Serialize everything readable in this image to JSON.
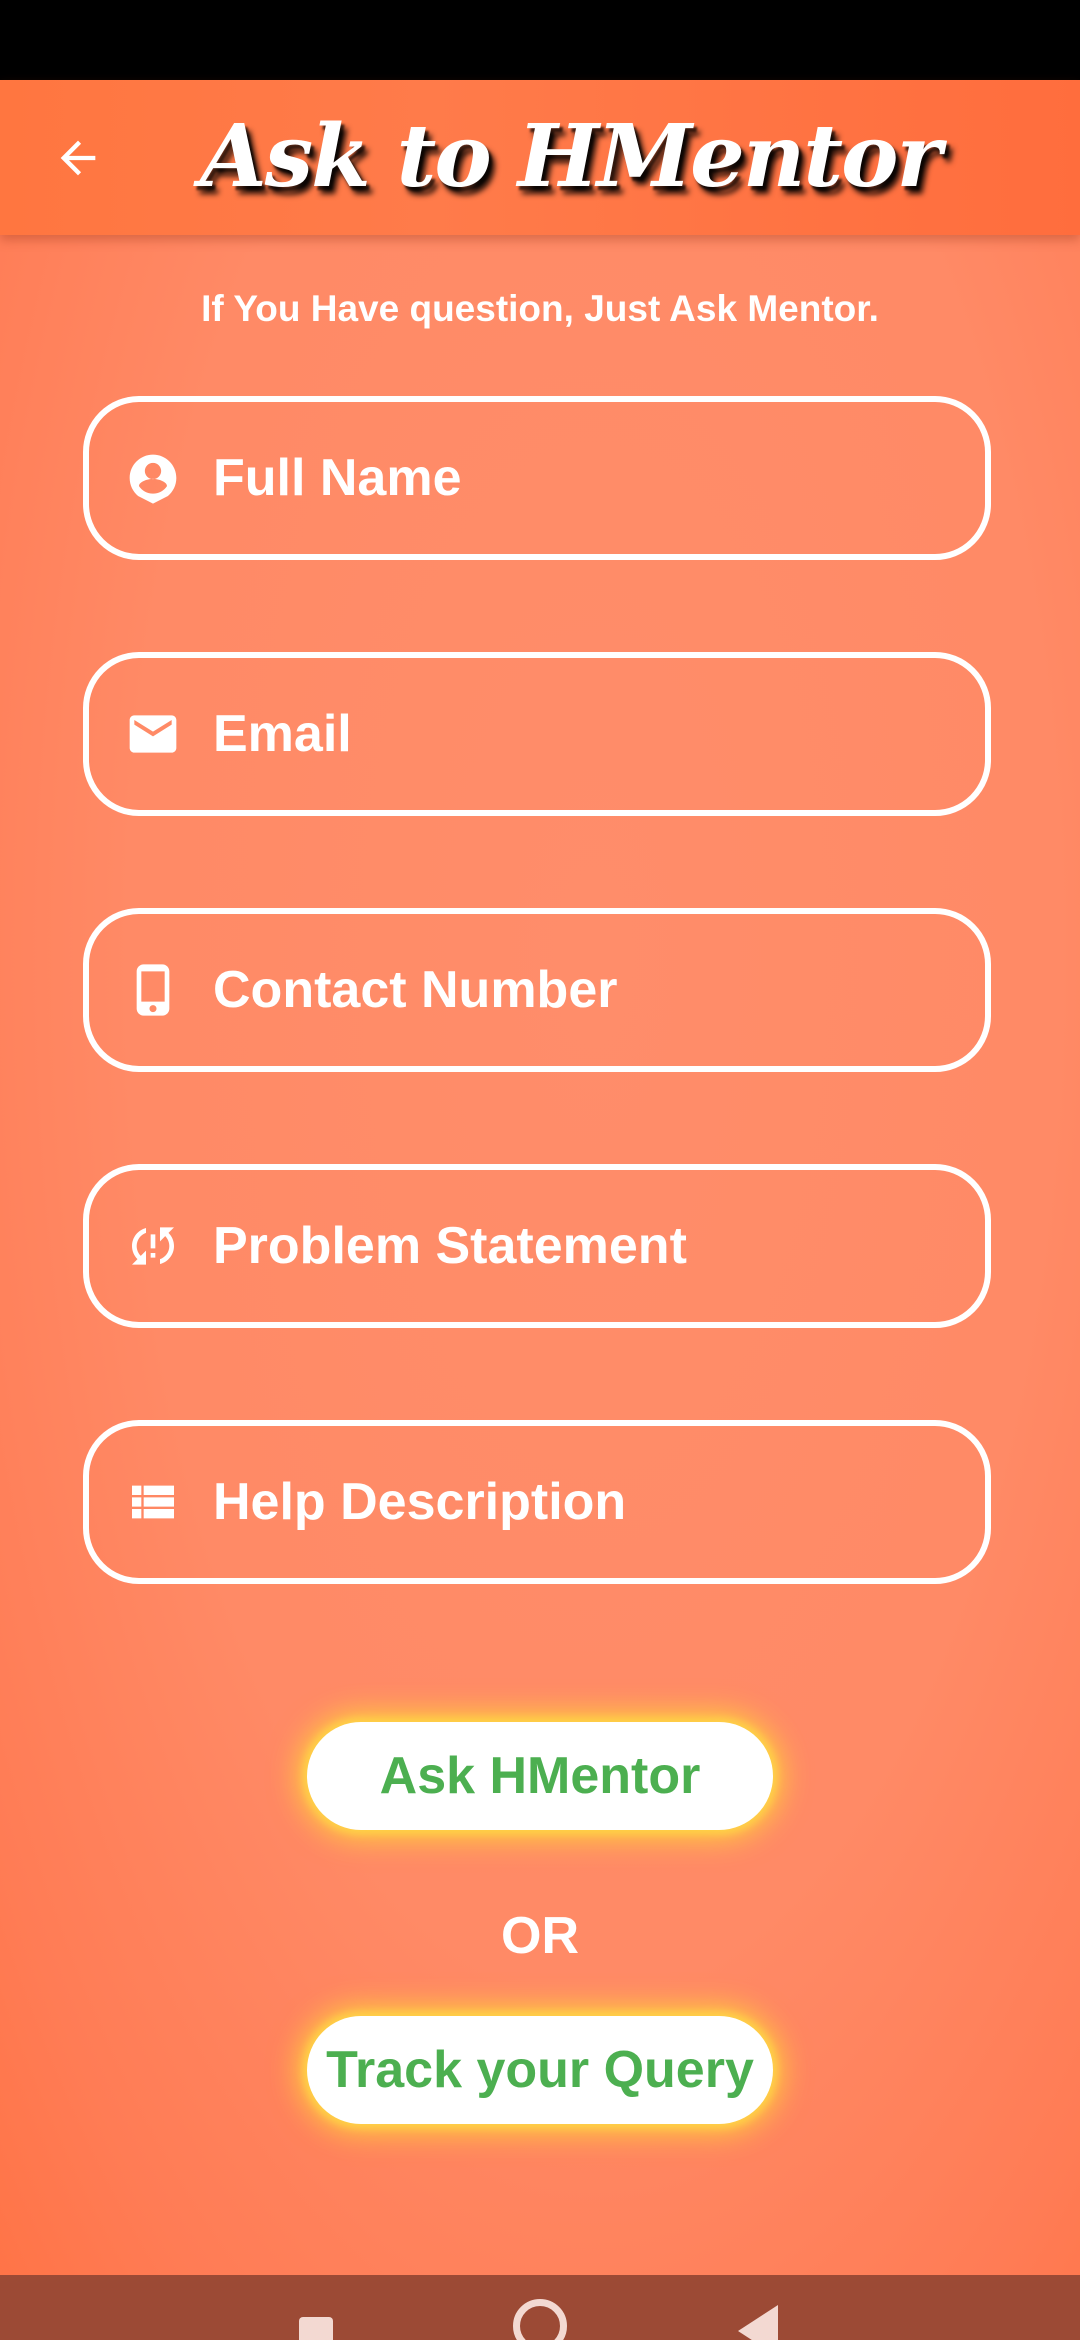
{
  "app_bar": {
    "title": "Ask to HMentor",
    "back_icon": "arrow-left-icon"
  },
  "subtitle": "If You Have question, Just Ask Mentor.",
  "form": {
    "fields": [
      {
        "label": "Full Name",
        "icon": "account-circle-icon"
      },
      {
        "label": "Email",
        "icon": "email-icon"
      },
      {
        "label": "Contact Number",
        "icon": "phone-icon"
      },
      {
        "label": "Problem Statement",
        "icon": "problem-sync-icon"
      },
      {
        "label": "Help Description",
        "icon": "list-icon"
      }
    ]
  },
  "actions": {
    "ask_label": "Ask HMentor",
    "or_label": "OR",
    "track_label": "Track your Query"
  },
  "colors": {
    "background": "#ff8a66",
    "app_bar": "#ff7640",
    "button_text": "#4caf50",
    "button_glow": "#ffd23c",
    "nav_bar": "#9c4a35"
  }
}
